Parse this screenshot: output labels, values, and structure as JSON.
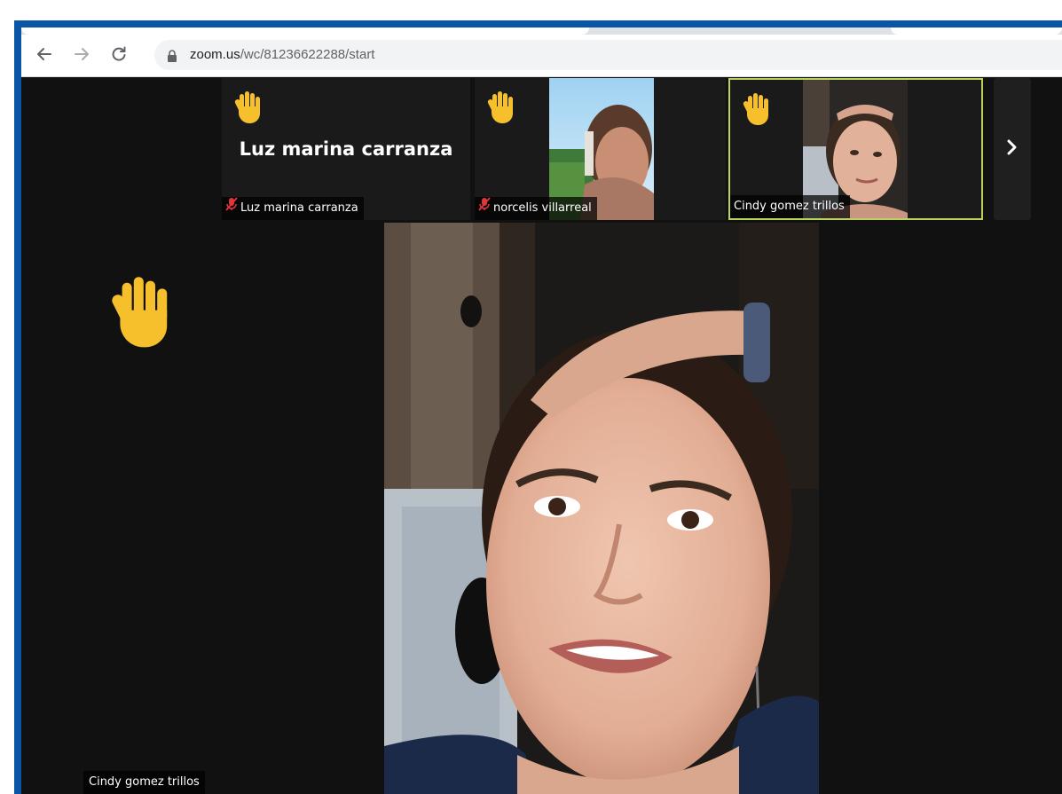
{
  "browser": {
    "url_host": "zoom.us",
    "url_path": "/wc/81236622288/start",
    "icons": [
      "back-arrow-icon",
      "forward-arrow-icon",
      "reload-icon",
      "lock-icon"
    ]
  },
  "gallery": {
    "thumbnails": [
      {
        "name": "Luz marina carranza",
        "display_name": "Luz marina carranza",
        "muted": true,
        "hand_raised": true,
        "video": false,
        "active": false
      },
      {
        "name": "norcelis villarreal",
        "muted": true,
        "hand_raised": true,
        "video": true,
        "active": false
      },
      {
        "name": "Cindy gomez trillos",
        "muted": false,
        "hand_raised": true,
        "video": true,
        "active": true
      }
    ],
    "next_icon": "chevron-right-icon"
  },
  "main": {
    "speaker_name": "Cindy gomez trillos",
    "hand_raised": true
  },
  "colors": {
    "frame": "#0a56a6",
    "zoom_background": "#111111",
    "active_border": "#b9d35c",
    "muted_red": "#e0353b",
    "hand_yellow": "#f5c02b"
  }
}
